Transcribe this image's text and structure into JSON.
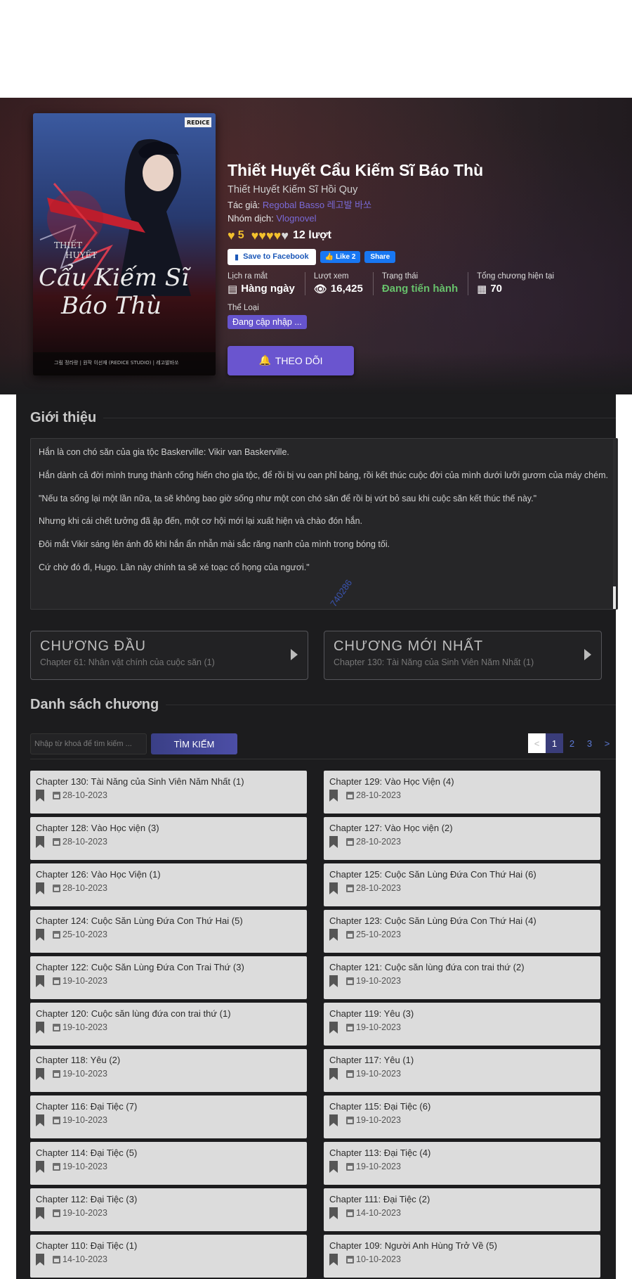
{
  "manga": {
    "title": "Thiết Huyết Cẩu Kiếm Sĩ Báo Thù",
    "alt_title": "Thiết Huyết Kiếm Sĩ Hồi Quy",
    "author_label": "Tác giả:",
    "author": "Regobal Basso 레고발 바쏘",
    "translator_label": "Nhóm dịch:",
    "translator": "Vlognovel",
    "rating_score": "5",
    "rating_count": "12 lượt",
    "rating_hearts_filled": 4,
    "rating_hearts_total": 5
  },
  "social": {
    "save_label": "Save to Facebook",
    "like_label": "Like 2",
    "share_label": "Share"
  },
  "stats": {
    "release_label": "Lịch ra mắt",
    "release_value": "Hàng ngày",
    "views_label": "Lượt xem",
    "views_value": "16,425",
    "status_label": "Trạng thái",
    "status_value": "Đang tiến hành",
    "chapters_label": "Tổng chương hiện tại",
    "chapters_value": "70"
  },
  "genre": {
    "label": "Thể Loại",
    "tag": "Đang cập nhập ..."
  },
  "follow_label": "THEO DÕI",
  "intro": {
    "title": "Giới thiệu",
    "paragraphs": [
      "Hắn là con chó săn của gia tộc Baskerville: Vikir van Baskerville.",
      "Hắn dành cả đời mình trung thành cống hiến cho gia tộc, để rồi bị vu oan phỉ báng, rồi kết thúc cuộc đời của mình dưới lưỡi gươm của máy chém.",
      "\"Nếu ta sống lại một lần nữa, ta sẽ không bao giờ sống như một con chó săn để rồi bị vứt bỏ sau khi cuộc săn kết thúc thế này.\"",
      "Nhưng khi cái chết tưởng đã ập đến, một cơ hội mới lại xuất hiện và chào đón hắn.",
      "Đôi mắt Vikir sáng lên ánh đỏ khi hắn ẩn nhẫn mài sắc răng nanh của mình trong bóng tối.",
      "Cứ chờ đó đi, Hugo. Lần này chính ta sẽ xé toạc cổ họng của ngươi.\""
    ],
    "watermark": "740286"
  },
  "nav": {
    "first_label": "CHƯƠNG ĐẦU",
    "first_chapter": "Chapter 61: Nhân vật chính của cuộc săn (1)",
    "latest_label": "CHƯƠNG MỚI NHẤT",
    "latest_chapter": "Chapter 130: Tài Năng của Sinh Viên Năm Nhất (1)"
  },
  "chapter_list": {
    "title": "Danh sách chương",
    "search_placeholder": "Nhập từ khoá để tìm kiếm ...",
    "search_button": "TÌM KIẾM",
    "pager": {
      "prev": "<",
      "pages": [
        "1",
        "2",
        "3"
      ],
      "next": ">"
    },
    "chapters": [
      {
        "name": "Chapter 130: Tài Năng của Sinh Viên Năm Nhất (1)",
        "date": "28-10-2023"
      },
      {
        "name": "Chapter 129: Vào Học Viện (4)",
        "date": "28-10-2023"
      },
      {
        "name": "Chapter 128: Vào Học viện (3)",
        "date": "28-10-2023"
      },
      {
        "name": "Chapter 127: Vào Học viện (2)",
        "date": "28-10-2023"
      },
      {
        "name": "Chapter 126: Vào Học Viện (1)",
        "date": "28-10-2023"
      },
      {
        "name": "Chapter 125: Cuộc Săn Lùng Đứa Con Thứ Hai (6)",
        "date": "28-10-2023"
      },
      {
        "name": "Chapter 124: Cuộc Săn Lùng Đứa Con Thứ Hai (5)",
        "date": "25-10-2023"
      },
      {
        "name": "Chapter 123: Cuộc Săn Lùng Đứa Con Thứ Hai (4)",
        "date": "25-10-2023"
      },
      {
        "name": "Chapter 122: Cuộc Săn Lùng Đứa Con Trai Thứ (3)",
        "date": "19-10-2023"
      },
      {
        "name": "Chapter 121: Cuộc săn lùng đứa con trai thứ (2)",
        "date": "19-10-2023"
      },
      {
        "name": "Chapter 120: Cuộc săn lùng đứa con trai thứ (1)",
        "date": "19-10-2023"
      },
      {
        "name": "Chapter 119: Yêu (3)",
        "date": "19-10-2023"
      },
      {
        "name": "Chapter 118: Yêu (2)",
        "date": "19-10-2023"
      },
      {
        "name": "Chapter 117: Yêu (1)",
        "date": "19-10-2023"
      },
      {
        "name": "Chapter 116: Đại Tiệc (7)",
        "date": "19-10-2023"
      },
      {
        "name": "Chapter 115: Đại Tiệc (6)",
        "date": "19-10-2023"
      },
      {
        "name": "Chapter 114: Đại Tiệc (5)",
        "date": "19-10-2023"
      },
      {
        "name": "Chapter 113: Đại Tiệc (4)",
        "date": "19-10-2023"
      },
      {
        "name": "Chapter 112: Đại Tiệc (3)",
        "date": "19-10-2023"
      },
      {
        "name": "Chapter 111: Đại Tiệc (2)",
        "date": "14-10-2023"
      },
      {
        "name": "Chapter 110: Đại Tiệc (1)",
        "date": "14-10-2023"
      },
      {
        "name": "Chapter 109: Người Anh Hùng Trở Về (5)",
        "date": "10-10-2023"
      }
    ]
  },
  "colors": {
    "accent": "#6a55cf",
    "status_green": "#67c06b",
    "heart": "#f3c12d",
    "link": "#7a6ad8"
  },
  "cover": {
    "publisher_logo": "REDICE",
    "logo_text": "THIẾT HUYẾT Cẩu Kiếm Sĩ Báo Thù",
    "credits": "그림 정라랑 | 원작 이선재 (REDICE STUDIO) | 레고발바쏘"
  }
}
